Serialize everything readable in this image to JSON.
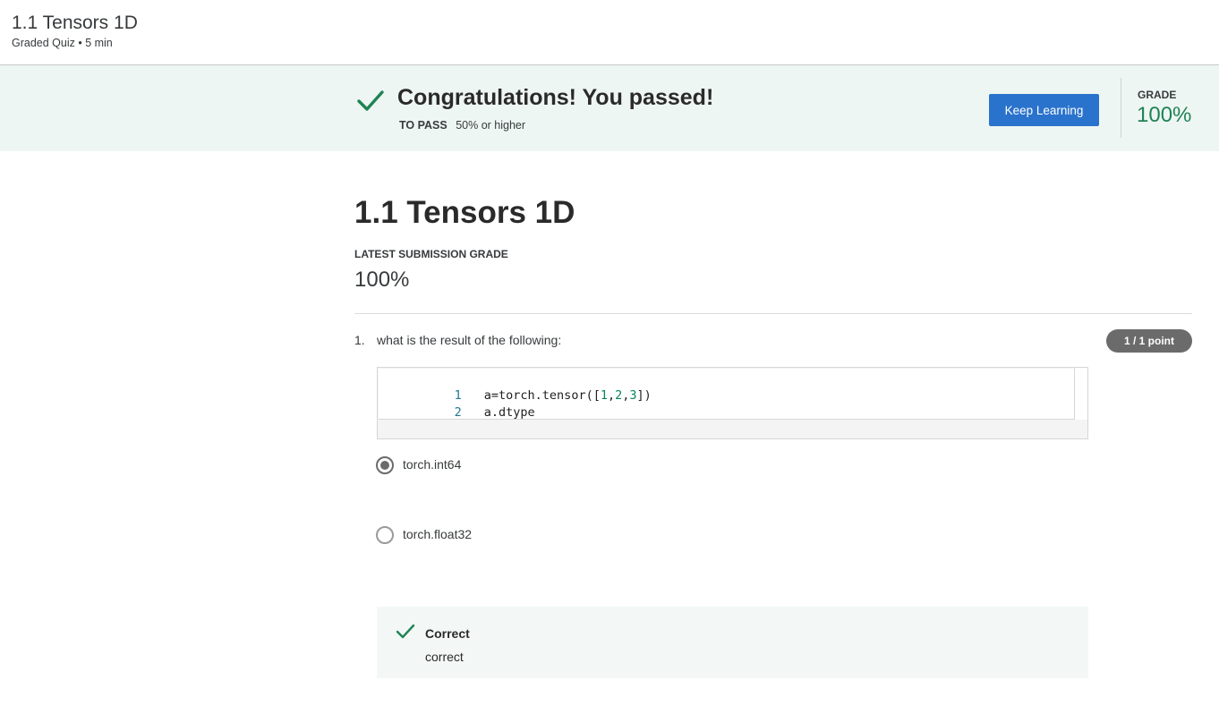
{
  "header": {
    "title": "1.1 Tensors 1D",
    "meta": "Graded Quiz • 5 min"
  },
  "banner": {
    "headline": "Congratulations! You passed!",
    "to_pass_label": "TO PASS",
    "to_pass_value": "50% or higher",
    "keep_learning_label": "Keep Learning",
    "grade_label": "GRADE",
    "grade_value": "100%",
    "accent_color": "#1f8354",
    "button_color": "#2a73cc"
  },
  "quiz": {
    "title": "1.1 Tensors 1D",
    "submission_label": "LATEST SUBMISSION GRADE",
    "submission_value": "100%"
  },
  "question": {
    "number": "1.",
    "text": "what is the result of the following:",
    "points": "1 / 1 point",
    "code": {
      "lines": [
        {
          "num": "1",
          "parts": [
            "a=torch.tensor([",
            "1",
            ",",
            "2",
            ",",
            "3",
            "])"
          ]
        },
        {
          "num": "2",
          "parts": [
            "a.dtype"
          ]
        }
      ]
    },
    "options": [
      {
        "label": "torch.int64",
        "selected": true
      },
      {
        "label": "torch.float32",
        "selected": false
      }
    ],
    "feedback": {
      "title": "Correct",
      "body": "correct"
    }
  },
  "icons": {
    "banner_check": "check-icon",
    "feedback_check": "check-icon"
  }
}
